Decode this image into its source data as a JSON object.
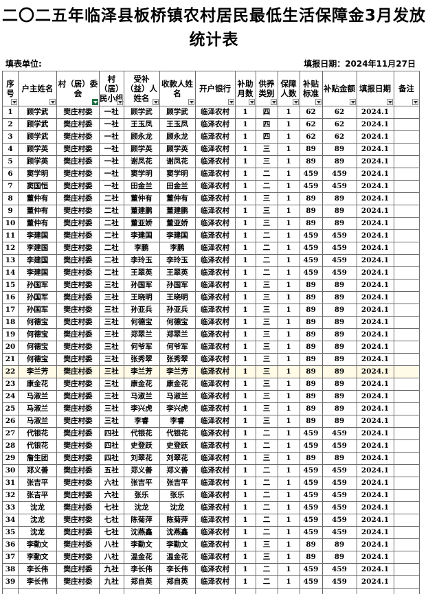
{
  "title": "二〇二五年临泽县板桥镇农村居民最低生活保障金3月发放统计表",
  "filler_label": "填表单位:",
  "report_date_label": "填报日期：2024年11月27日",
  "colors": {
    "grid": "#6a6a6a",
    "selected_row": "#fffbe6",
    "filter_active": "#1f7244"
  },
  "headers": [
    "序号",
    "户主姓名",
    "村（居）委会",
    "村（居）民小组",
    "受补（益）人姓名",
    "收款人姓名",
    "开户银行",
    "补助月数",
    "供养类别",
    "保障人数",
    "补贴标准",
    "补贴金额",
    "填报日期",
    "备注"
  ],
  "rows": [
    [
      "1",
      "顾学武",
      "樊庄村委",
      "一社",
      "顾学武",
      "顾学武",
      "临泽农村",
      "1",
      "四",
      "1",
      "62",
      "62",
      "2024.1",
      ""
    ],
    [
      "2",
      "顾学武",
      "樊庄村委",
      "一社",
      "王玉凤",
      "王玉凤",
      "临泽农村",
      "1",
      "四",
      "1",
      "62",
      "62",
      "2024.1",
      ""
    ],
    [
      "3",
      "顾学武",
      "樊庄村委",
      "一社",
      "顾永龙",
      "顾永龙",
      "临泽农村",
      "1",
      "四",
      "1",
      "62",
      "62",
      "2024.1",
      ""
    ],
    [
      "4",
      "顾学英",
      "樊庄村委",
      "一社",
      "顾学英",
      "顾学英",
      "临泽农村",
      "1",
      "三",
      "1",
      "89",
      "89",
      "2024.1",
      ""
    ],
    [
      "5",
      "顾学英",
      "樊庄村委",
      "一社",
      "谢凤花",
      "谢凤花",
      "临泽农村",
      "1",
      "三",
      "1",
      "89",
      "89",
      "2024.1",
      ""
    ],
    [
      "6",
      "窦学明",
      "樊庄村委",
      "一社",
      "窦学明",
      "窦学明",
      "临泽农村",
      "1",
      "二",
      "1",
      "459",
      "459",
      "2024.1",
      ""
    ],
    [
      "7",
      "窦国恒",
      "樊庄村委",
      "一社",
      "田金兰",
      "田金兰",
      "临泽农村",
      "1",
      "二",
      "1",
      "459",
      "459",
      "2024.1",
      ""
    ],
    [
      "8",
      "董仲有",
      "樊庄村委",
      "二社",
      "董仲有",
      "董仲有",
      "临泽农村",
      "1",
      "三",
      "1",
      "89",
      "89",
      "2024.1",
      ""
    ],
    [
      "9",
      "董仲有",
      "樊庄村委",
      "二社",
      "董建鹏",
      "董建鹏",
      "临泽农村",
      "1",
      "三",
      "1",
      "89",
      "89",
      "2024.1",
      ""
    ],
    [
      "10",
      "董仲有",
      "樊庄村委",
      "二社",
      "董亚娇",
      "董亚娇",
      "临泽农村",
      "1",
      "三",
      "1",
      "89",
      "89",
      "2024.1",
      ""
    ],
    [
      "11",
      "李建国",
      "樊庄村委",
      "二社",
      "李建国",
      "李建国",
      "临泽农村",
      "1",
      "二",
      "1",
      "459",
      "459",
      "2024.1",
      ""
    ],
    [
      "12",
      "李建国",
      "樊庄村委",
      "二社",
      "李鹏",
      "李鹏",
      "临泽农村",
      "1",
      "二",
      "1",
      "459",
      "459",
      "2024.1",
      ""
    ],
    [
      "13",
      "李建国",
      "樊庄村委",
      "二社",
      "李玲玉",
      "李玲玉",
      "临泽农村",
      "1",
      "二",
      "1",
      "459",
      "459",
      "2024.1",
      ""
    ],
    [
      "14",
      "李建国",
      "樊庄村委",
      "二社",
      "王翠英",
      "王翠英",
      "临泽农村",
      "1",
      "二",
      "1",
      "459",
      "459",
      "2024.1",
      ""
    ],
    [
      "15",
      "孙国军",
      "樊庄村委",
      "三社",
      "孙国军",
      "孙国军",
      "临泽农村",
      "1",
      "三",
      "1",
      "89",
      "89",
      "2024.1",
      ""
    ],
    [
      "16",
      "孙国军",
      "樊庄村委",
      "三社",
      "王晓明",
      "王晓明",
      "临泽农村",
      "1",
      "三",
      "1",
      "89",
      "89",
      "2024.1",
      ""
    ],
    [
      "17",
      "孙国军",
      "樊庄村委",
      "三社",
      "孙亚兵",
      "孙亚兵",
      "临泽农村",
      "1",
      "三",
      "1",
      "89",
      "89",
      "2024.1",
      ""
    ],
    [
      "18",
      "何德宝",
      "樊庄村委",
      "三社",
      "何德宝",
      "何德宝",
      "临泽农村",
      "1",
      "三",
      "1",
      "89",
      "89",
      "2024.1",
      ""
    ],
    [
      "19",
      "何德宝",
      "樊庄村委",
      "三社",
      "郑翠兰",
      "郑翠兰",
      "临泽农村",
      "1",
      "三",
      "1",
      "89",
      "89",
      "2024.1",
      ""
    ],
    [
      "20",
      "何德宝",
      "樊庄村委",
      "三社",
      "何爷军",
      "何爷军",
      "临泽农村",
      "1",
      "三",
      "1",
      "89",
      "89",
      "2024.1",
      ""
    ],
    [
      "21",
      "何德宝",
      "樊庄村委",
      "三社",
      "张秀翠",
      "张秀翠",
      "临泽农村",
      "1",
      "三",
      "1",
      "89",
      "89",
      "2024.1",
      ""
    ],
    [
      "22",
      "李兰芳",
      "樊庄村委",
      "三社",
      "李兰芳",
      "李兰芳",
      "临泽农村",
      "1",
      "三",
      "1",
      "89",
      "89",
      "2024.1",
      ""
    ],
    [
      "23",
      "康金花",
      "樊庄村委",
      "三社",
      "康金花",
      "康金花",
      "临泽农村",
      "1",
      "三",
      "1",
      "89",
      "89",
      "2024.1",
      ""
    ],
    [
      "24",
      "马淑兰",
      "樊庄村委",
      "三社",
      "马淑兰",
      "马淑兰",
      "临泽农村",
      "1",
      "三",
      "1",
      "89",
      "89",
      "2024.1",
      ""
    ],
    [
      "25",
      "马淑兰",
      "樊庄村委",
      "三社",
      "李兴虎",
      "李兴虎",
      "临泽农村",
      "1",
      "三",
      "1",
      "89",
      "89",
      "2024.1",
      ""
    ],
    [
      "26",
      "马淑兰",
      "樊庄村委",
      "三社",
      "李睿",
      "李睿",
      "临泽农村",
      "1",
      "三",
      "1",
      "89",
      "89",
      "2024.1",
      ""
    ],
    [
      "27",
      "代银花",
      "樊庄村委",
      "四社",
      "代银花",
      "代银花",
      "临泽农村",
      "1",
      "二",
      "1",
      "459",
      "459",
      "2024.1",
      ""
    ],
    [
      "28",
      "代银花",
      "樊庄村委",
      "四社",
      "史登跃",
      "史登跃",
      "临泽农村",
      "1",
      "二",
      "1",
      "459",
      "459",
      "2024.1",
      ""
    ],
    [
      "29",
      "詹生团",
      "樊庄村委",
      "四社",
      "刘翠花",
      "刘翠花",
      "临泽农村",
      "1",
      "三",
      "1",
      "89",
      "89",
      "2024.1",
      ""
    ],
    [
      "30",
      "郑义善",
      "樊庄村委",
      "五社",
      "郑义善",
      "郑义善",
      "临泽农村",
      "1",
      "二",
      "1",
      "459",
      "459",
      "2024.1",
      ""
    ],
    [
      "31",
      "张吉平",
      "樊庄村委",
      "六社",
      "张吉平",
      "张吉平",
      "临泽农村",
      "1",
      "二",
      "1",
      "459",
      "459",
      "2024.1",
      ""
    ],
    [
      "32",
      "张吉平",
      "樊庄村委",
      "六社",
      "张乐",
      "张乐",
      "临泽农村",
      "1",
      "二",
      "1",
      "459",
      "459",
      "2024.1",
      ""
    ],
    [
      "33",
      "沈龙",
      "樊庄村委",
      "七社",
      "沈龙",
      "沈龙",
      "临泽农村",
      "1",
      "二",
      "1",
      "459",
      "459",
      "2024.1",
      ""
    ],
    [
      "34",
      "沈龙",
      "樊庄村委",
      "七社",
      "陈菊萍",
      "陈菊萍",
      "临泽农村",
      "1",
      "二",
      "1",
      "459",
      "459",
      "2024.1",
      ""
    ],
    [
      "35",
      "沈龙",
      "樊庄村委",
      "七社",
      "沈燕鑫",
      "沈燕鑫",
      "临泽农村",
      "1",
      "二",
      "1",
      "459",
      "459",
      "2024.1",
      ""
    ],
    [
      "36",
      "李勤文",
      "樊庄村委",
      "八社",
      "李勤文",
      "李勤文",
      "临泽农村",
      "1",
      "三",
      "1",
      "89",
      "89",
      "2024.1",
      ""
    ],
    [
      "37",
      "李勤文",
      "樊庄村委",
      "八社",
      "温金花",
      "温金花",
      "临泽农村",
      "1",
      "三",
      "1",
      "89",
      "89",
      "2024.1",
      ""
    ],
    [
      "38",
      "李长伟",
      "樊庄村委",
      "九社",
      "李长伟",
      "李长伟",
      "临泽农村",
      "1",
      "二",
      "1",
      "459",
      "459",
      "2024.1",
      ""
    ],
    [
      "39",
      "李长伟",
      "樊庄村委",
      "九社",
      "郑自英",
      "郑自英",
      "临泽农村",
      "1",
      "二",
      "1",
      "459",
      "459",
      "2024.1",
      ""
    ]
  ],
  "selected_row": 22
}
